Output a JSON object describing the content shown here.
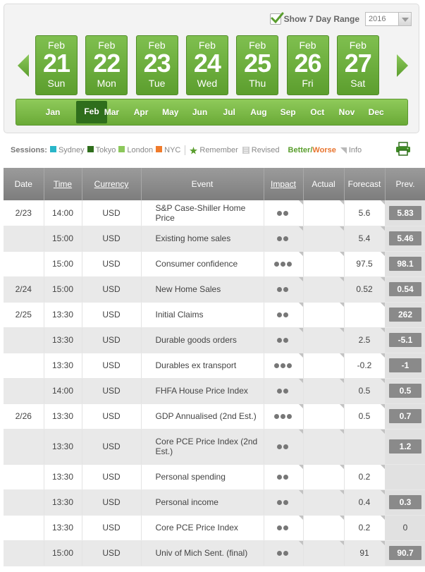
{
  "range": {
    "label": "Show 7 Day Range",
    "checked": true,
    "year": "2016"
  },
  "days": [
    {
      "month": "Feb",
      "day": "21",
      "dow": "Sun"
    },
    {
      "month": "Feb",
      "day": "22",
      "dow": "Mon"
    },
    {
      "month": "Feb",
      "day": "23",
      "dow": "Tue"
    },
    {
      "month": "Feb",
      "day": "24",
      "dow": "Wed"
    },
    {
      "month": "Feb",
      "day": "25",
      "dow": "Thu"
    },
    {
      "month": "Feb",
      "day": "26",
      "dow": "Fri"
    },
    {
      "month": "Feb",
      "day": "27",
      "dow": "Sat"
    }
  ],
  "months": [
    "Jan",
    "Feb",
    "Mar",
    "Apr",
    "May",
    "Jun",
    "Jul",
    "Aug",
    "Sep",
    "Oct",
    "Nov",
    "Dec"
  ],
  "selected_month": "Feb",
  "legend": {
    "sessions_label": "Sessions:",
    "sessions": [
      {
        "name": "Sydney",
        "color": "#29b6c9"
      },
      {
        "name": "Tokyo",
        "color": "#2f6e1c"
      },
      {
        "name": "London",
        "color": "#8cc85b"
      },
      {
        "name": "NYC",
        "color": "#f07b2b"
      }
    ],
    "remember": "Remember",
    "revised": "Revised",
    "better": "Better",
    "slash": " / ",
    "worse": "Worse",
    "info": "Info"
  },
  "colors": {
    "green": "#6aaa37",
    "dark_green": "#2f6e1c",
    "orange": "#e8742e"
  },
  "table": {
    "headers": {
      "date": "Date",
      "time": "Time",
      "currency": "Currency",
      "event": "Event",
      "impact": "Impact",
      "actual": "Actual",
      "forecast": "Forecast",
      "prev": "Prev."
    },
    "rows": [
      {
        "date": "2/23",
        "time": "14:00",
        "currency": "USD",
        "event": "S&P Case-Shiller Home Price",
        "impact": 2,
        "actual": "",
        "forecast": "5.6",
        "prev": "5.83",
        "prev_boxed": true
      },
      {
        "date": "",
        "time": "15:00",
        "currency": "USD",
        "event": "Existing home sales",
        "impact": 2,
        "actual": "",
        "forecast": "5.4",
        "prev": "5.46",
        "prev_boxed": true
      },
      {
        "date": "",
        "time": "15:00",
        "currency": "USD",
        "event": "Consumer confidence",
        "impact": 3,
        "actual": "",
        "forecast": "97.5",
        "prev": "98.1",
        "prev_boxed": true
      },
      {
        "date": "2/24",
        "time": "15:00",
        "currency": "USD",
        "event": "New Home Sales",
        "impact": 2,
        "actual": "",
        "forecast": "0.52",
        "prev": "0.54",
        "prev_boxed": true
      },
      {
        "date": "2/25",
        "time": "13:30",
        "currency": "USD",
        "event": "Initial Claims",
        "impact": 2,
        "actual": "",
        "forecast": "",
        "prev": "262",
        "prev_boxed": true
      },
      {
        "date": "",
        "time": "13:30",
        "currency": "USD",
        "event": "Durable goods orders",
        "impact": 2,
        "actual": "",
        "forecast": "2.5",
        "prev": "-5.1",
        "prev_boxed": true
      },
      {
        "date": "",
        "time": "13:30",
        "currency": "USD",
        "event": "Durables ex transport",
        "impact": 3,
        "actual": "",
        "forecast": "-0.2",
        "prev": "-1",
        "prev_boxed": true
      },
      {
        "date": "",
        "time": "14:00",
        "currency": "USD",
        "event": "FHFA House Price Index",
        "impact": 2,
        "actual": "",
        "forecast": "0.5",
        "prev": "0.5",
        "prev_boxed": true
      },
      {
        "date": "2/26",
        "time": "13:30",
        "currency": "USD",
        "event": "GDP Annualised (2nd Est.)",
        "impact": 3,
        "actual": "",
        "forecast": "0.5",
        "prev": "0.7",
        "prev_boxed": true
      },
      {
        "date": "",
        "time": "13:30",
        "currency": "USD",
        "event": "Core PCE Price Index (2nd Est.)",
        "impact": 2,
        "actual": "",
        "forecast": "",
        "prev": "1.2",
        "prev_boxed": true,
        "tall": true
      },
      {
        "date": "",
        "time": "13:30",
        "currency": "USD",
        "event": "Personal spending",
        "impact": 2,
        "actual": "",
        "forecast": "0.2",
        "prev": "",
        "prev_boxed": false
      },
      {
        "date": "",
        "time": "13:30",
        "currency": "USD",
        "event": "Personal income",
        "impact": 2,
        "actual": "",
        "forecast": "0.4",
        "prev": "0.3",
        "prev_boxed": true
      },
      {
        "date": "",
        "time": "13:30",
        "currency": "USD",
        "event": "Core PCE Price Index",
        "impact": 2,
        "actual": "",
        "forecast": "0.2",
        "prev": "0",
        "prev_boxed": false
      },
      {
        "date": "",
        "time": "15:00",
        "currency": "USD",
        "event": "Univ of Mich Sent. (final)",
        "impact": 2,
        "actual": "",
        "forecast": "91",
        "prev": "90.7",
        "prev_boxed": true
      }
    ]
  }
}
